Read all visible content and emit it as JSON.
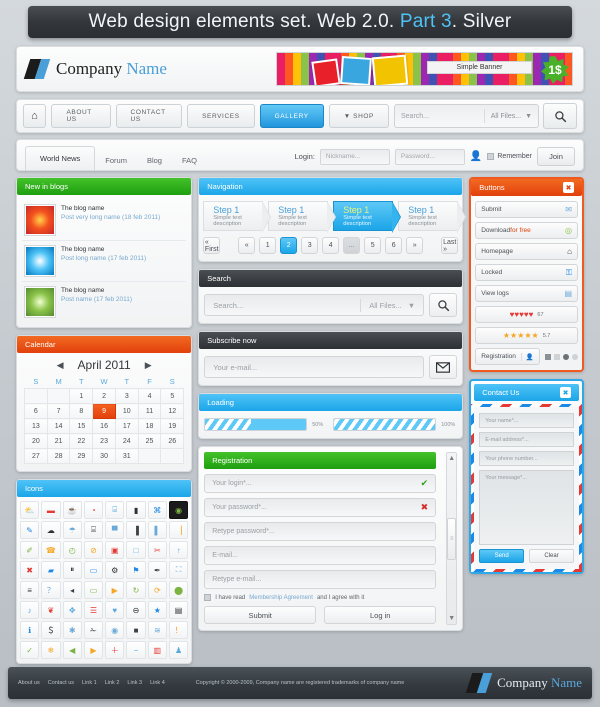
{
  "title": {
    "pre": "Web design elements set. Web 2.0. ",
    "accent": "Part 3",
    "post": ". Silver"
  },
  "header": {
    "company": "Company",
    "company_accent": "Name",
    "banner_label": "Simple Banner",
    "banner_price": "1$"
  },
  "mainnav": {
    "home_icon": "home-icon",
    "items": [
      "ABOUT US",
      "CONTACT US",
      "SERVICES",
      "GALLERY",
      "SHOP"
    ],
    "active": "GALLERY",
    "search_placeholder": "Search...",
    "filter_value": "All Files...",
    "search_icon": "search-icon"
  },
  "tabs": {
    "items": [
      "World News",
      "Forum",
      "Blog",
      "FAQ"
    ],
    "active": "World News",
    "login_label": "Login:",
    "nickname_placeholder": "Nickname...",
    "password_placeholder": "Password...",
    "remember_label": "Remember",
    "join_label": "Join"
  },
  "blogs": {
    "title": "New in blogs",
    "items": [
      {
        "name": "The blog name",
        "post": "Post very long name (18 feb 2011)"
      },
      {
        "name": "The blog name",
        "post": "Post long name (17 feb 2011)"
      },
      {
        "name": "The blog name",
        "post": "Post name (17 feb 2011)"
      }
    ]
  },
  "calendar": {
    "title": "Calendar",
    "month": "April 2011",
    "prev": "◀",
    "next": "▶",
    "weekdays": [
      "S",
      "M",
      "T",
      "W",
      "T",
      "F",
      "S"
    ],
    "weeks": [
      [
        "",
        "",
        "1",
        "2",
        "3",
        "4",
        "5"
      ],
      [
        "6",
        "7",
        "8",
        "9",
        "10",
        "11",
        "12"
      ],
      [
        "13",
        "14",
        "15",
        "16",
        "17",
        "18",
        "19"
      ],
      [
        "20",
        "21",
        "22",
        "23",
        "24",
        "25",
        "26"
      ],
      [
        "27",
        "28",
        "29",
        "30",
        "31",
        "",
        ""
      ]
    ],
    "today": "9"
  },
  "icons": {
    "title": "Icons",
    "glyphs": [
      "⛅",
      "▬",
      "☕",
      "◔",
      "⌸",
      "▮",
      "⌘",
      "◉",
      "✎",
      "☁",
      "☂",
      "⌸",
      "▀",
      "▐",
      "▌",
      "▕",
      "✐",
      "☎",
      "◴",
      "⊘",
      "▣",
      "□",
      "✂",
      "↑",
      "✖",
      "▰",
      "⏸",
      "▭",
      "⚙",
      "⚑",
      "✒",
      "⛶",
      "≡",
      "？",
      "◂",
      "▭",
      "▶",
      "↻",
      "⟳",
      "⬤",
      "♪",
      "❦",
      "✥",
      "☰",
      "♥",
      "⊖",
      "★",
      "▤",
      "ℹ",
      "＄",
      "✱",
      "✁",
      "◉",
      "■",
      "≋",
      "！",
      "✓",
      "❄",
      "◀",
      "▶",
      "＋",
      "−",
      "▥",
      "♟"
    ]
  },
  "navigation": {
    "title": "Navigation",
    "steps": [
      {
        "n": "Step 1",
        "d": "Simple text description"
      },
      {
        "n": "Step 1",
        "d": "Simple text description"
      },
      {
        "n": "Step 1",
        "d": "Simple text description"
      },
      {
        "n": "Step 1",
        "d": "Simple text description"
      }
    ],
    "active_step": 2,
    "pager": {
      "first": "« First",
      "prev": "«",
      "pages": [
        "1",
        "2",
        "3",
        "4",
        "...",
        "5",
        "6"
      ],
      "current": "2",
      "next": "»",
      "last": "Last »"
    }
  },
  "search_panel": {
    "title": "Search",
    "placeholder": "Search...",
    "filter_value": "All Files...",
    "button_icon": "search-icon"
  },
  "subscribe": {
    "title": "Subscribe now",
    "placeholder": "Your e-mail...",
    "button_icon": "envelope-icon"
  },
  "loading": {
    "title": "Loading",
    "bars": [
      {
        "pct": 50,
        "label": "50%"
      },
      {
        "pct": 100,
        "label": "100%"
      }
    ]
  },
  "buttons": {
    "title": "Buttons",
    "close_icon": "close-icon",
    "rows": [
      {
        "label": "Submit",
        "icon": "✉",
        "icon_name": "envelope-icon"
      },
      {
        "label": "Download ",
        "accent": "for free",
        "icon": "◎",
        "icon_name": "download-icon"
      },
      {
        "label": "Homepage",
        "icon": "⌂",
        "icon_name": "home-icon"
      },
      {
        "label": "Locked",
        "icon": "⚿",
        "icon_name": "lock-icon"
      },
      {
        "label": "View logs",
        "icon": "▤",
        "icon_name": "document-icon"
      }
    ],
    "hearts": {
      "glyph": "♥",
      "count": 5,
      "value": "67"
    },
    "stars": {
      "glyph": "★",
      "count": 5,
      "value": "5.7"
    },
    "registration_label": "Registration",
    "registration_icon": "user-icon"
  },
  "registration": {
    "title": "Registration",
    "fields": [
      {
        "placeholder": "Your login*...",
        "mark": "✔",
        "mark_state": "ok"
      },
      {
        "placeholder": "Your password*...",
        "mark": "✖",
        "mark_state": "bad"
      },
      {
        "placeholder": "Retype password*...",
        "mark": "",
        "mark_state": ""
      },
      {
        "placeholder": "E-mail...",
        "mark": "",
        "mark_state": ""
      },
      {
        "placeholder": "Retype e-mail...",
        "mark": "",
        "mark_state": ""
      }
    ],
    "agree_pre": "I have read ",
    "agree_link": "Membership Agreement",
    "agree_post": " and I agree with it",
    "submit": "Submit",
    "login": "Log in"
  },
  "contact": {
    "title": "Contact Us",
    "close_icon": "close-icon",
    "fields": [
      "Your name*...",
      "E-mail address*...",
      "Your phone number..."
    ],
    "message_placeholder": "Your message*...",
    "send": "Send",
    "clear": "Clear"
  },
  "footer": {
    "links": [
      "About us",
      "Contact us",
      "Link 1",
      "Link 2",
      "Link 3",
      "Link 4"
    ],
    "copyright": "Copyright © 2000-2009, Company name are registered trademarks of company name",
    "company": "Company",
    "company_accent": "Name"
  }
}
